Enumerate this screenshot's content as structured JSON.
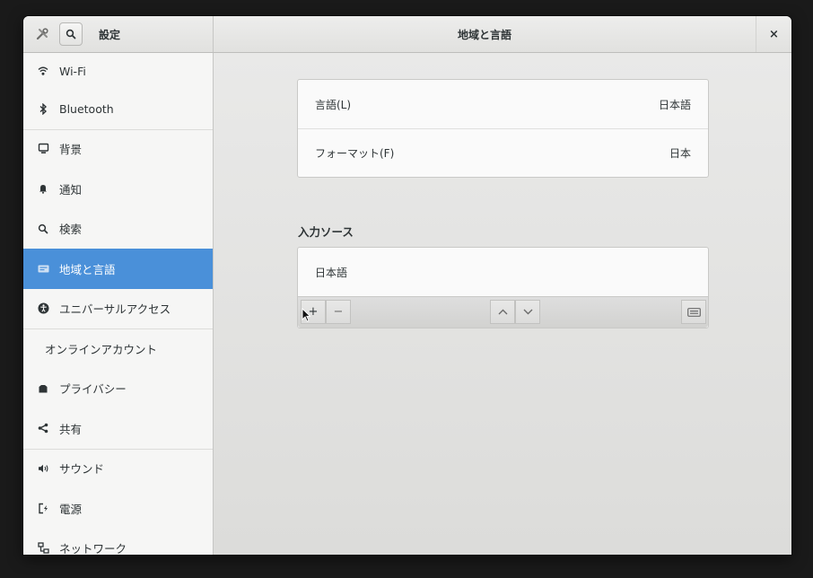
{
  "window": {
    "app_title": "設定",
    "page_title": "地域と言語",
    "close_label": "×"
  },
  "icons": {
    "tools": "tools-icon",
    "search": "search-icon",
    "close": "close-icon",
    "add": "add-icon",
    "remove": "remove-icon",
    "up": "chevron-up-icon",
    "down": "chevron-down-icon",
    "keyboard": "keyboard-icon"
  },
  "colors": {
    "selection": "#4a90d9",
    "window_bg": "#e8e8e7",
    "sidebar_bg": "#f6f6f5"
  },
  "sidebar": {
    "items": [
      {
        "label": "Wi-Fi",
        "icon": "wifi-icon"
      },
      {
        "label": "Bluetooth",
        "icon": "bluetooth-icon"
      },
      {
        "label": "背景",
        "icon": "background-icon"
      },
      {
        "label": "通知",
        "icon": "bell-icon"
      },
      {
        "label": "検索",
        "icon": "search-icon"
      },
      {
        "label": "地域と言語",
        "icon": "region-icon",
        "selected": true
      },
      {
        "label": "ユニバーサルアクセス",
        "icon": "accessibility-icon"
      },
      {
        "label": "オンラインアカウント",
        "icon": ""
      },
      {
        "label": "プライバシー",
        "icon": "privacy-icon"
      },
      {
        "label": "共有",
        "icon": "share-icon"
      },
      {
        "label": "サウンド",
        "icon": "speaker-icon"
      },
      {
        "label": "電源",
        "icon": "power-icon"
      },
      {
        "label": "ネットワーク",
        "icon": "network-icon"
      }
    ]
  },
  "region": {
    "language_label": "言語(L)",
    "language_value": "日本語",
    "format_label": "フォーマット(F)",
    "format_value": "日本",
    "input_sources_title": "入力ソース",
    "input_sources": [
      "日本語"
    ],
    "add_label": "+",
    "remove_label": "−"
  }
}
